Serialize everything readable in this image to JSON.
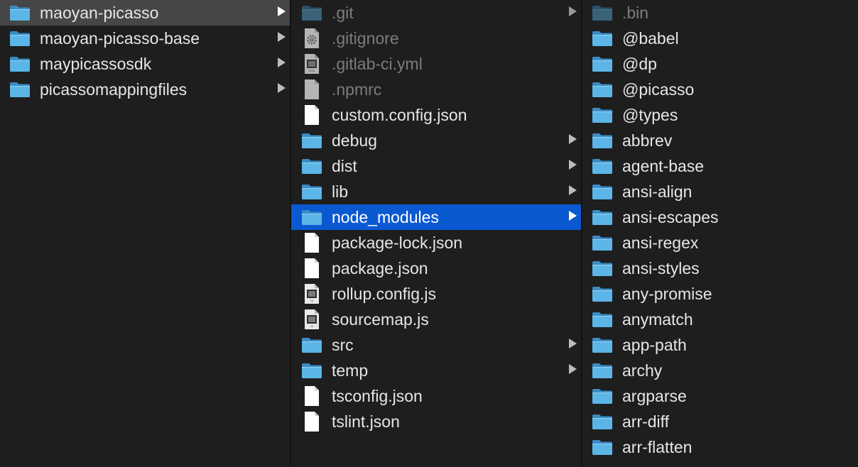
{
  "colors": {
    "background": "#1e1e1e",
    "selection_active": "#0b59d1",
    "selection_inactive": "#464646",
    "folder_blue": "#5bb5e6",
    "text": "#e6e6e6",
    "text_dim": "#7c7c7c"
  },
  "columns": [
    {
      "items": [
        {
          "label": "maoyan-picasso",
          "icon": "folder-icon",
          "arrow": true,
          "selected": "inactive"
        },
        {
          "label": "maoyan-picasso-base",
          "icon": "folder-icon",
          "arrow": true
        },
        {
          "label": "maypicassosdk",
          "icon": "folder-icon",
          "arrow": true
        },
        {
          "label": "picassomappingfiles",
          "icon": "folder-icon",
          "arrow": true
        }
      ]
    },
    {
      "items": [
        {
          "label": ".git",
          "icon": "folder-icon",
          "arrow": true,
          "dim": true
        },
        {
          "label": ".gitignore",
          "icon": "settings-file-icon",
          "dim": true
        },
        {
          "label": ".gitlab-ci.yml",
          "icon": "yaml-file-icon",
          "dim": true,
          "badge": "YAML"
        },
        {
          "label": ".npmrc",
          "icon": "generic-file-icon",
          "dim": true
        },
        {
          "label": "custom.config.json",
          "icon": "document-icon"
        },
        {
          "label": "debug",
          "icon": "folder-icon",
          "arrow": true
        },
        {
          "label": "dist",
          "icon": "folder-icon",
          "arrow": true
        },
        {
          "label": "lib",
          "icon": "folder-icon",
          "arrow": true
        },
        {
          "label": "node_modules",
          "icon": "folder-icon",
          "arrow": true,
          "selected": "active"
        },
        {
          "label": "package-lock.json",
          "icon": "document-icon"
        },
        {
          "label": "package.json",
          "icon": "document-icon"
        },
        {
          "label": "rollup.config.js",
          "icon": "js-file-icon",
          "badge": "JS"
        },
        {
          "label": "sourcemap.js",
          "icon": "js-file-icon",
          "badge": "JS"
        },
        {
          "label": "src",
          "icon": "folder-icon",
          "arrow": true
        },
        {
          "label": "temp",
          "icon": "folder-icon",
          "arrow": true
        },
        {
          "label": "tsconfig.json",
          "icon": "document-icon"
        },
        {
          "label": "tslint.json",
          "icon": "document-icon"
        }
      ]
    },
    {
      "items": [
        {
          "label": ".bin",
          "icon": "folder-icon",
          "dim": true
        },
        {
          "label": "@babel",
          "icon": "folder-icon"
        },
        {
          "label": "@dp",
          "icon": "folder-icon"
        },
        {
          "label": "@picasso",
          "icon": "folder-icon"
        },
        {
          "label": "@types",
          "icon": "folder-icon"
        },
        {
          "label": "abbrev",
          "icon": "folder-icon"
        },
        {
          "label": "agent-base",
          "icon": "folder-icon"
        },
        {
          "label": "ansi-align",
          "icon": "folder-icon"
        },
        {
          "label": "ansi-escapes",
          "icon": "folder-icon"
        },
        {
          "label": "ansi-regex",
          "icon": "folder-icon"
        },
        {
          "label": "ansi-styles",
          "icon": "folder-icon"
        },
        {
          "label": "any-promise",
          "icon": "folder-icon"
        },
        {
          "label": "anymatch",
          "icon": "folder-icon"
        },
        {
          "label": "app-path",
          "icon": "folder-icon"
        },
        {
          "label": "archy",
          "icon": "folder-icon"
        },
        {
          "label": "argparse",
          "icon": "folder-icon"
        },
        {
          "label": "arr-diff",
          "icon": "folder-icon"
        },
        {
          "label": "arr-flatten",
          "icon": "folder-icon"
        }
      ]
    }
  ]
}
